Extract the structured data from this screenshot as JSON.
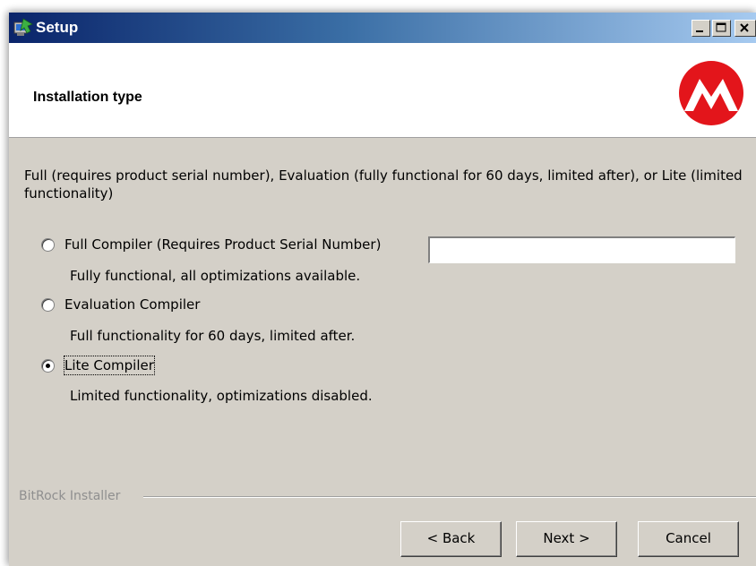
{
  "window": {
    "title": "Setup"
  },
  "header": {
    "title": "Installation type",
    "logo": "microchip-logo"
  },
  "description": "Full (requires product serial number), Evaluation (fully functional for 60 days, limited after), or Lite (limited functionality)",
  "options": [
    {
      "label": "Full Compiler (Requires Product Serial Number)",
      "description": "Fully functional, all optimizations available.",
      "selected": false
    },
    {
      "label": "Evaluation Compiler",
      "description": "Full functionality for 60 days, limited after.",
      "selected": false
    },
    {
      "label": "Lite Compiler",
      "description": "Limited functionality, optimizations disabled.",
      "selected": true
    }
  ],
  "serial_field": {
    "value": ""
  },
  "footer": {
    "installer_label": "BitRock Installer",
    "back_label": "< Back",
    "next_label": "Next >",
    "cancel_label": "Cancel"
  },
  "colors": {
    "titlebar_start": "#0a246a",
    "titlebar_end": "#a6caf0",
    "logo_red": "#e3151b",
    "dialog_bg": "#d4d0c8"
  },
  "icons": {
    "app": "setup-app-icon",
    "minimize": "minimize-icon",
    "maximize": "maximize-icon",
    "close": "close-icon"
  }
}
